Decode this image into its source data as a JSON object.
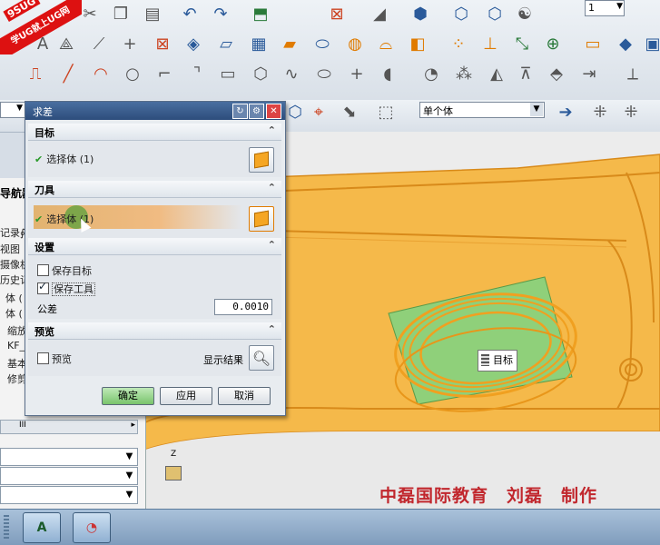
{
  "banner": {
    "logo_text": "9SUG",
    "ribbon_text": "学UG就上UG网"
  },
  "toolbar": {
    "layer_field": "1",
    "select_filter": "单个体"
  },
  "navigator": {
    "title": "导航器",
    "items": [
      "记录∮",
      "视图",
      "摄像机",
      "历史记",
      "体 (",
      "体 (",
      "缩放",
      "KF_",
      "基本",
      "修剪"
    ],
    "scroll_label": "III"
  },
  "dialog": {
    "title": "求差",
    "target": {
      "header": "目标",
      "select_label": "选择体 (1)"
    },
    "tool": {
      "header": "刀具",
      "select_label": "选择体 (1)"
    },
    "settings": {
      "header": "设置",
      "keep_target_label": "保存目标",
      "keep_target_checked": false,
      "keep_tool_label": "保存工具",
      "keep_tool_checked": true,
      "tolerance_label": "公差",
      "tolerance_value": "0.0010"
    },
    "preview": {
      "header": "预览",
      "preview_label": "预览",
      "show_result_label": "显示结果"
    },
    "buttons": {
      "ok": "确定",
      "apply": "应用",
      "cancel": "取消"
    }
  },
  "viewport": {
    "target_tag": "目标",
    "caption": "中磊国际教育　刘磊　制作",
    "axis_label": "Z"
  },
  "colors": {
    "part": "#f5b94a",
    "selection_green": "#8fd07a",
    "caption_red": "#c1272d",
    "title_blue": "#2d4d7c"
  }
}
